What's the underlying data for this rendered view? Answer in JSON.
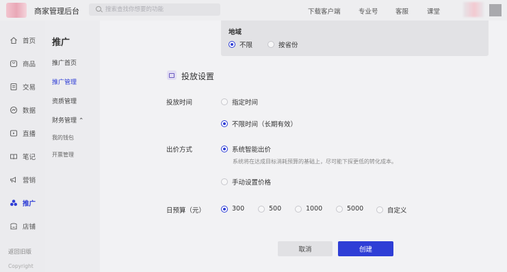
{
  "header": {
    "app_title": "商家管理后台",
    "search_placeholder": "搜索查找你想要的功能",
    "links": [
      "下载客户端",
      "专业号",
      "客服",
      "课堂"
    ]
  },
  "nav": {
    "items": [
      {
        "label": "首页",
        "icon": "home-icon"
      },
      {
        "label": "商品",
        "icon": "product-icon"
      },
      {
        "label": "交易",
        "icon": "order-icon"
      },
      {
        "label": "数据",
        "icon": "data-icon"
      },
      {
        "label": "直播",
        "icon": "live-icon"
      },
      {
        "label": "笔记",
        "icon": "notes-icon"
      },
      {
        "label": "营销",
        "icon": "marketing-icon"
      },
      {
        "label": "推广",
        "icon": "promotion-icon",
        "active": true
      },
      {
        "label": "店铺",
        "icon": "store-icon"
      }
    ],
    "back_old": "返回旧版",
    "copyright": "Copyright"
  },
  "subnav": {
    "title": "推广",
    "items": [
      "推广首页",
      "推广管理",
      "资质管理",
      "财务管理 ⌃",
      "我的钱包",
      "开票管理"
    ]
  },
  "region": {
    "title": "地域",
    "options": [
      "不限",
      "按省份"
    ],
    "selected": "不限"
  },
  "section": {
    "title": "投放设置"
  },
  "delivery_time": {
    "label": "投放时间",
    "options": [
      "指定时间",
      "不限时间（长期有效）"
    ],
    "selected": "不限时间（长期有效）"
  },
  "bid_method": {
    "label": "出价方式",
    "options": [
      "系统智能出价",
      "手动设置价格"
    ],
    "selected": "系统智能出价",
    "hint": "系统将在达成目标消耗预算的基础上，尽可能下探更低的转化成本。"
  },
  "daily_budget": {
    "label": "日预算（元）",
    "options": [
      "300",
      "500",
      "1000",
      "5000",
      "自定义"
    ],
    "selected": "300"
  },
  "actions": {
    "cancel": "取消",
    "create": "创建"
  },
  "colors": {
    "accent": "#2f3ed6",
    "background": "#f2f2f4"
  }
}
